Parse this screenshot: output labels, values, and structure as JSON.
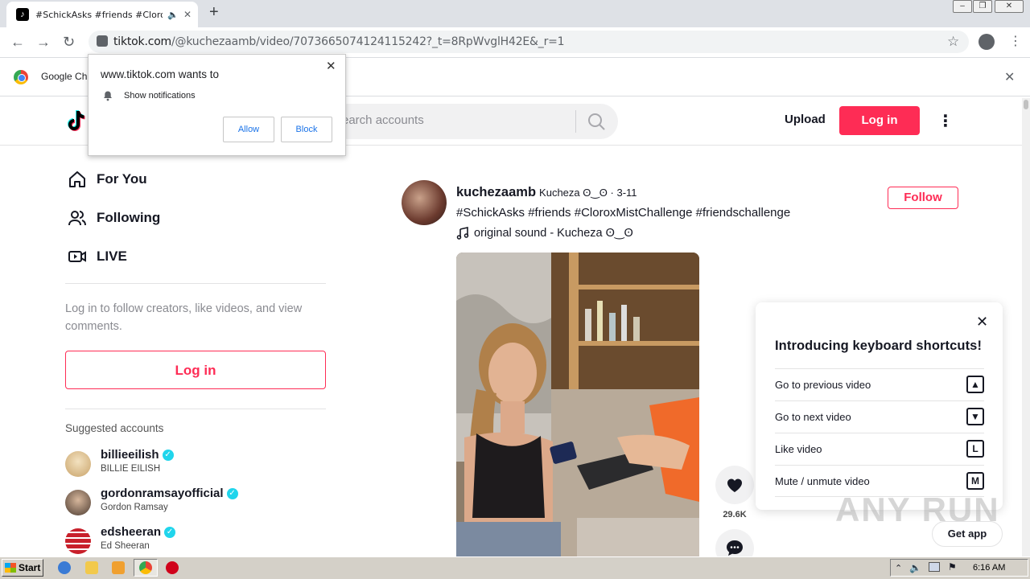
{
  "browser": {
    "tab_title": "#SchickAsks #friends #CloroxMistChallenge",
    "tab_close": "✕",
    "new_tab": "+",
    "url_host": "tiktok.com",
    "url_path": "/@kuchezaamb/video/7073665074124115242?_t=8RpWvglH42E&_r=1",
    "infobar_text": "Google Ch",
    "window_buttons": [
      "–",
      "❐",
      "✕"
    ]
  },
  "permission_popup": {
    "title": "www.tiktok.com wants to",
    "permission": "Show notifications",
    "allow": "Allow",
    "block": "Block"
  },
  "tiktok_header": {
    "search_placeholder": "Search accounts",
    "search_visible": "earch accounts",
    "upload": "Upload",
    "login": "Log in"
  },
  "sidebar": {
    "nav": [
      {
        "label": "For You",
        "icon": "home-icon"
      },
      {
        "label": "Following",
        "icon": "users-icon"
      },
      {
        "label": "LIVE",
        "icon": "live-icon"
      }
    ],
    "login_prompt": "Log in to follow creators, like videos, and view comments.",
    "login_button": "Log in",
    "suggested_title": "Suggested accounts",
    "accounts": [
      {
        "username": "billieeilish",
        "display": "BILLIE EILISH",
        "color": "#d9c29a"
      },
      {
        "username": "gordonramsayofficial",
        "display": "Gordon Ramsay",
        "color": "#6d5a4e"
      },
      {
        "username": "edsheeran",
        "display": "Ed Sheeran",
        "color": "#c8202b"
      }
    ]
  },
  "post": {
    "username": "kuchezaamb",
    "nickname": "Kucheza ʘ‿ʘ",
    "date": " · 3-11",
    "caption": "#SchickAsks #friends #CloroxMistChallenge #friendschallenge",
    "sound": "original sound - Kucheza ʘ‿ʘ",
    "follow": "Follow",
    "likes": "29.6K"
  },
  "shortcuts": {
    "title": "Introducing keyboard shortcuts!",
    "rows": [
      {
        "label": "Go to previous video",
        "key": "▲"
      },
      {
        "label": "Go to next video",
        "key": "▼"
      },
      {
        "label": "Like video",
        "key": "L"
      },
      {
        "label": "Mute / unmute video",
        "key": "M"
      }
    ]
  },
  "watermark": "ANY RUN",
  "get_app": "Get app",
  "taskbar": {
    "start": "Start",
    "clock": "6:16 AM"
  },
  "colors": {
    "brand": "#fe2c55",
    "verified": "#20d5ec"
  }
}
